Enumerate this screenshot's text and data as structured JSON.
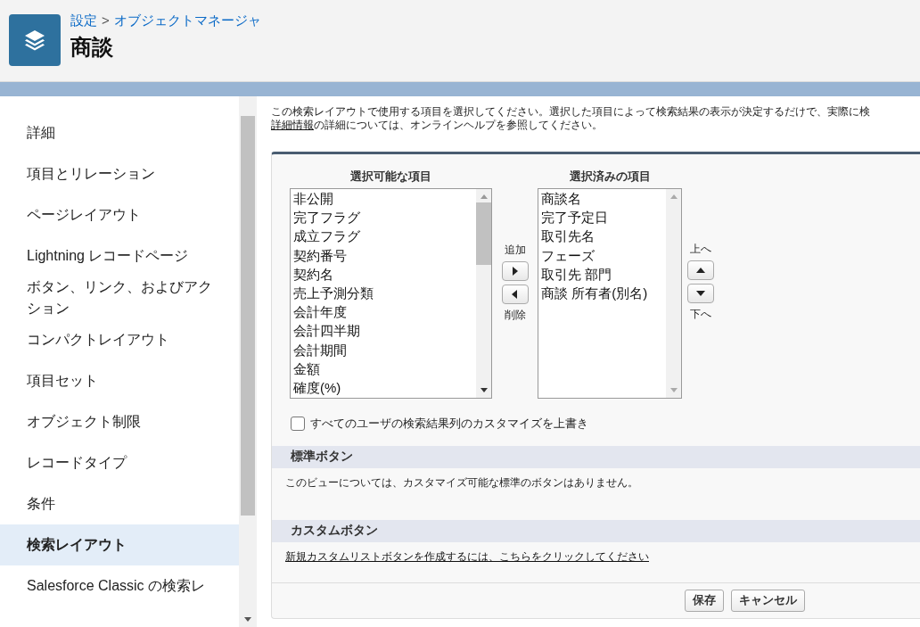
{
  "header": {
    "breadcrumb": [
      {
        "label": "設定"
      },
      {
        "label": "オブジェクトマネージャ"
      }
    ],
    "breadcrumb_separator": ">",
    "title": "商談"
  },
  "sidebar": {
    "items": [
      {
        "label": "詳細",
        "selected": false
      },
      {
        "label": "項目とリレーション",
        "selected": false
      },
      {
        "label": "ページレイアウト",
        "selected": false
      },
      {
        "label": "Lightning レコードページ",
        "selected": false
      },
      {
        "label": "ボタン、リンク、およびアクション",
        "selected": false
      },
      {
        "label": "コンパクトレイアウト",
        "selected": false
      },
      {
        "label": "項目セット",
        "selected": false
      },
      {
        "label": "オブジェクト制限",
        "selected": false
      },
      {
        "label": "レコードタイプ",
        "selected": false
      },
      {
        "label": "条件",
        "selected": false
      },
      {
        "label": "検索レイアウト",
        "selected": true
      },
      {
        "label": "Salesforce Classic の検索レ",
        "selected": false
      }
    ]
  },
  "intro": {
    "text": "この検索レイアウトで使用する項目を選択してください。選択した項目によって検索結果の表示が決定するだけで、実際に検",
    "link": "詳細情報",
    "rest": "の詳細については、オンラインヘルプを参照してください。"
  },
  "available": {
    "heading": "選択可能な項目",
    "items": [
      "非公開",
      "完了フラグ",
      "成立フラグ",
      "契約番号",
      "契約名",
      "売上予測分類",
      "会計年度",
      "会計四半期",
      "会計期間",
      "金額",
      "確度(%)"
    ]
  },
  "selected": {
    "heading": "選択済みの項目",
    "items": [
      "商談名",
      "完了予定日",
      "取引先名",
      "フェーズ",
      "取引先 部門",
      "商談 所有者(別名)"
    ]
  },
  "move": {
    "add": "追加",
    "remove": "削除"
  },
  "order": {
    "up": "上へ",
    "down": "下へ"
  },
  "override": {
    "label": "すべてのユーザの検索結果列のカスタマイズを上書き",
    "checked": false
  },
  "standard_buttons": {
    "heading": "標準ボタン",
    "text": "このビューについては、カスタマイズ可能な標準のボタンはありません。"
  },
  "custom_buttons": {
    "heading": "カスタムボタン",
    "link": "新規カスタムリストボタンを作成するには、こちらをクリックしてください"
  },
  "buttons": [
    {
      "label": "保存"
    },
    {
      "label": "キャンセル"
    }
  ]
}
